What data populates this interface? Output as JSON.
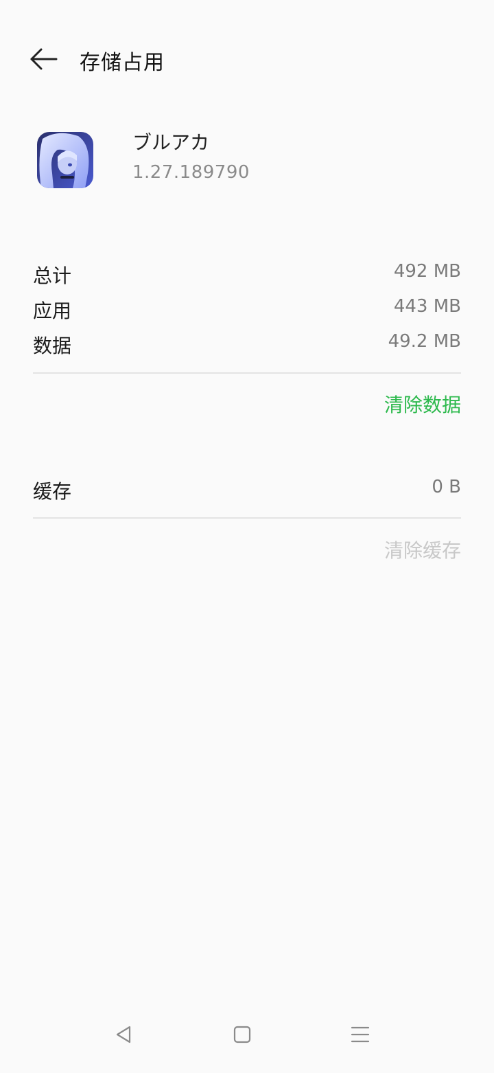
{
  "header": {
    "title": "存储占用",
    "back_icon": "arrow-left-icon"
  },
  "app": {
    "name": "ブルアカ",
    "version": "1.27.189790",
    "icon": "app-icon-anime-character"
  },
  "storage": {
    "rows": [
      {
        "label": "总计",
        "value": "492 MB"
      },
      {
        "label": "应用",
        "value": "443 MB"
      },
      {
        "label": "数据",
        "value": "49.2 MB"
      }
    ],
    "clear_data_label": "清除数据",
    "cache_label": "缓存",
    "cache_value": "0 B",
    "clear_cache_label": "清除缓存"
  },
  "colors": {
    "accent": "#2db94d",
    "disabled": "#c8c8c8",
    "background": "#fafafa"
  },
  "navbar": {
    "icons": [
      "triangle-back-icon",
      "square-home-icon",
      "menu-recents-icon"
    ]
  }
}
